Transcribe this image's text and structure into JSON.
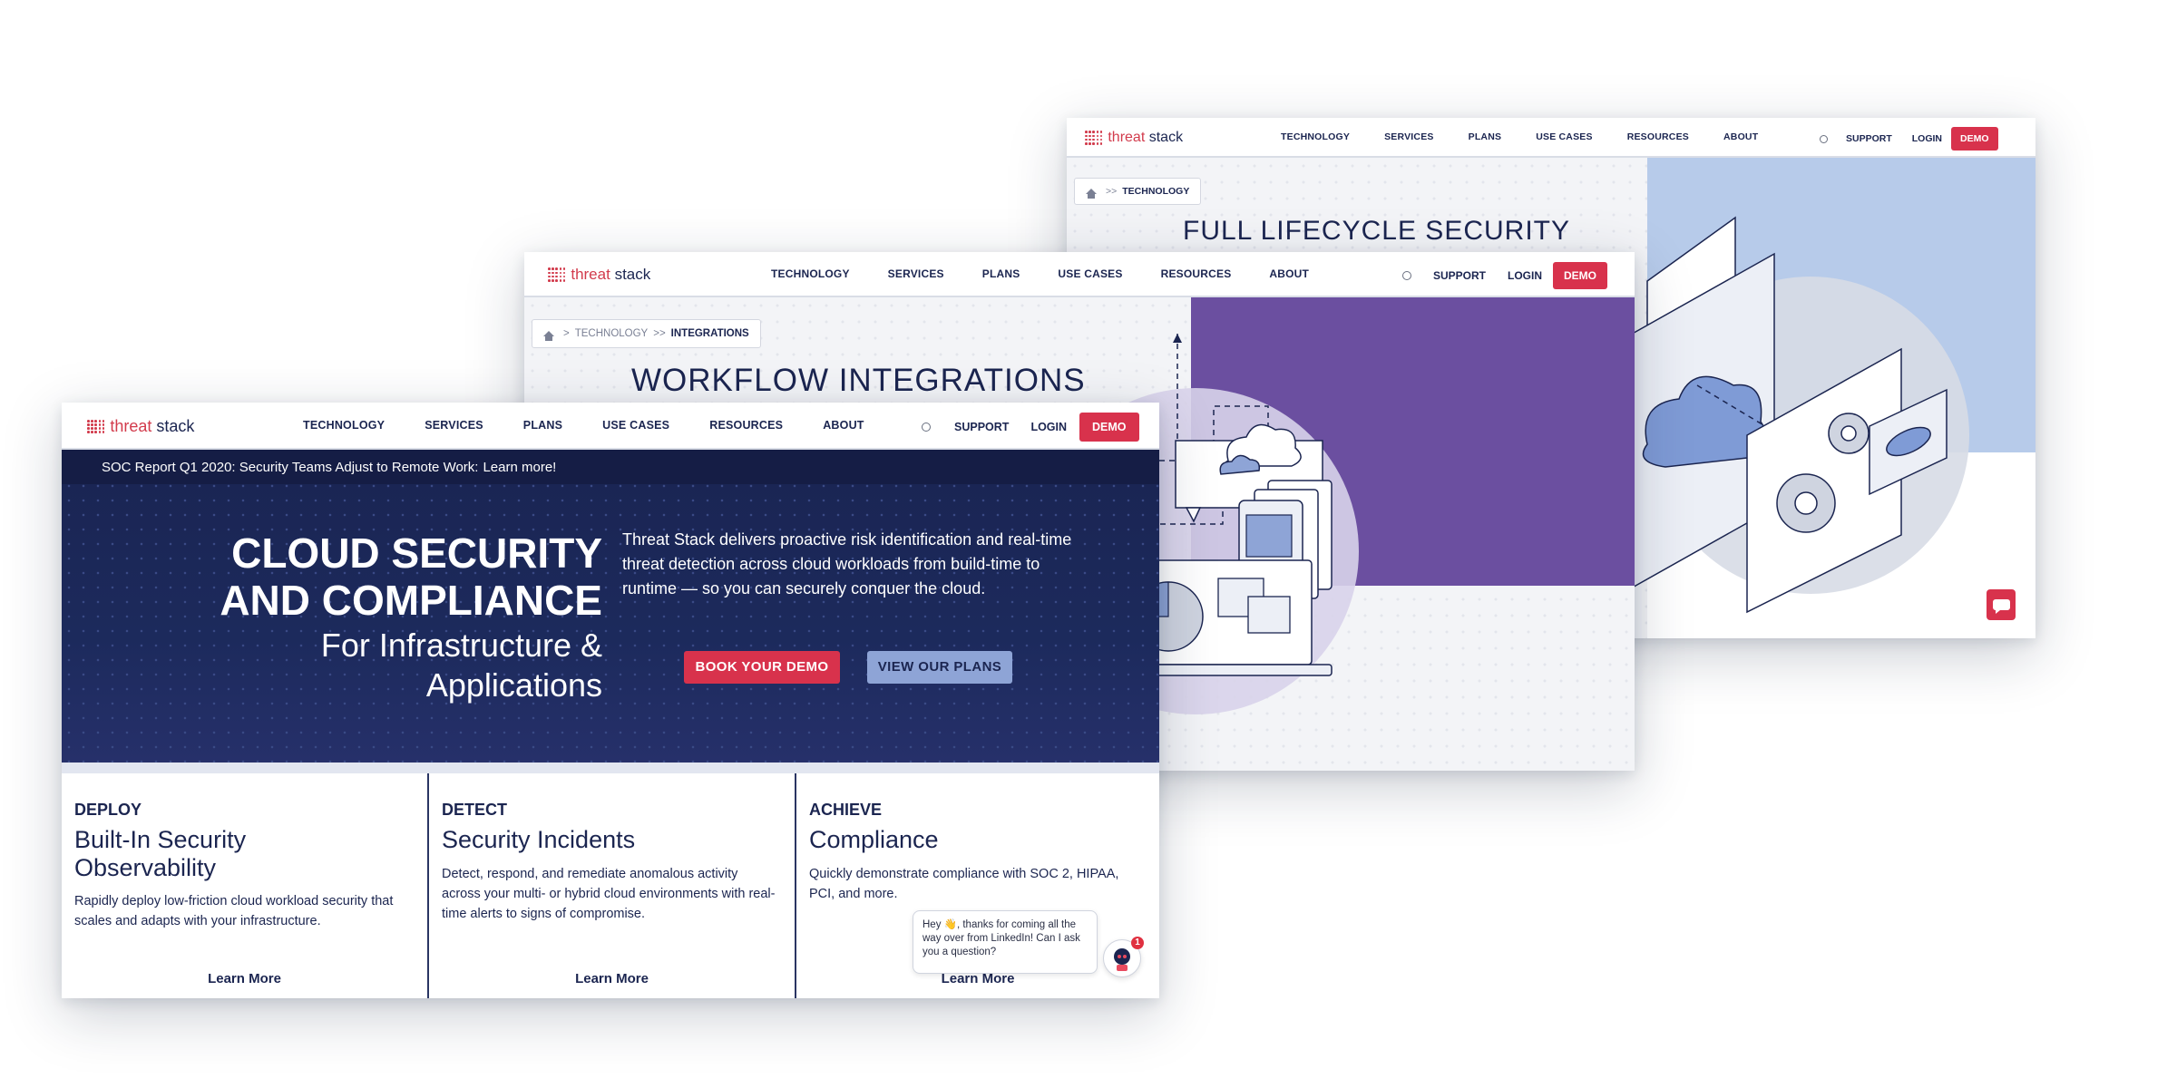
{
  "brand": {
    "word1": "threat",
    "word2": "stack"
  },
  "nav": {
    "items": [
      "TECHNOLOGY",
      "SERVICES",
      "PLANS",
      "USE CASES",
      "RESOURCES",
      "ABOUT"
    ],
    "support": "SUPPORT",
    "login": "LOGIN",
    "demo": "DEMO"
  },
  "back_window": {
    "breadcrumb": {
      "sep": ">>",
      "current": "TECHNOLOGY"
    },
    "heading": "FULL LIFECYCLE SECURITY"
  },
  "middle_window": {
    "breadcrumb": {
      "sep1": ">",
      "parent": "TECHNOLOGY",
      "sep2": ">>",
      "current": "INTEGRATIONS"
    },
    "heading": "WORKFLOW INTEGRATIONS"
  },
  "front_window": {
    "banner": {
      "text": "SOC Report Q1 2020: Security Teams Adjust to Remote Work:",
      "link": "Learn more!"
    },
    "hero": {
      "title_line1": "CLOUD SECURITY",
      "title_line2": "AND COMPLIANCE",
      "sub_line1": "For Infrastructure &",
      "sub_line2": "Applications",
      "description": "Threat Stack delivers proactive risk identification and real-time threat detection across cloud workloads from build-time to runtime — so you can securely conquer the cloud.",
      "book_demo": "BOOK YOUR DEMO",
      "view_plans": "VIEW OUR PLANS"
    },
    "columns": [
      {
        "kicker": "DEPLOY",
        "title": "Built-In Security Observability",
        "desc": "Rapidly deploy low-friction cloud workload security that scales and adapts with your infrastructure.",
        "more": "Learn More"
      },
      {
        "kicker": "DETECT",
        "title": "Security Incidents",
        "desc": "Detect, respond, and remediate anomalous activity across your multi- or hybrid cloud environments with real-time alerts to signs of compromise.",
        "more": "Learn More"
      },
      {
        "kicker": "ACHIEVE",
        "title": "Compliance",
        "desc": "Quickly demonstrate compliance with SOC 2, HIPAA, PCI, and more.",
        "more": "Learn More"
      }
    ],
    "chat": {
      "message": "Hey 👋, thanks for coming all the way over from LinkedIn! Can I ask you a question?",
      "badge": "1"
    }
  },
  "colors": {
    "accent_red": "#d8324c",
    "navy": "#1b2550",
    "purple": "#6b4fa0",
    "light_blue": "#b7cbea",
    "button_blue": "#8ea4d6"
  },
  "icons": [
    "logo-mark-icon",
    "search-icon",
    "home-icon",
    "cloud-icon",
    "gear-icon",
    "eye-icon",
    "phone-icon",
    "chat-icon",
    "bot-icon"
  ]
}
